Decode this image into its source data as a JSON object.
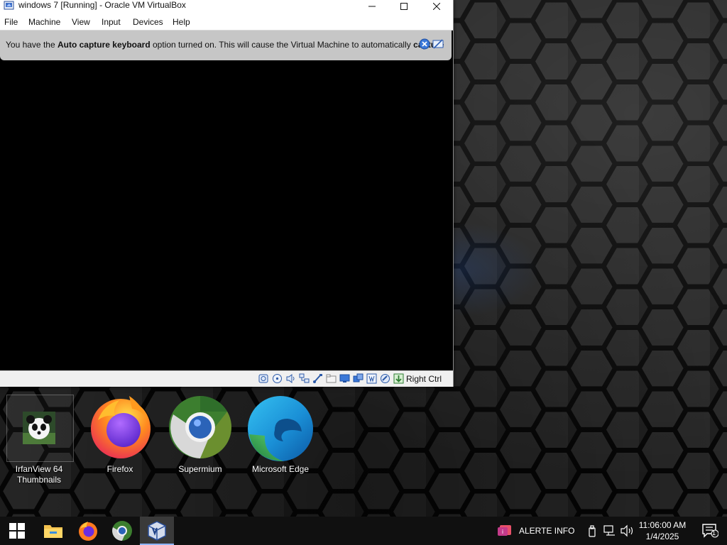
{
  "window": {
    "title": "windows 7 [Running] - Oracle VM VirtualBox",
    "menu": [
      "File",
      "Machine",
      "View",
      "Input",
      "Devices",
      "Help"
    ]
  },
  "notice": {
    "text_1": "You have the ",
    "bold_1": "Auto capture keyboard",
    "text_2": " option turned on. This will cause the Virtual Machine to automatically ",
    "bold_2": "capture"
  },
  "statusbar": {
    "icons": [
      "hard-disk-icon",
      "optical-drive-icon",
      "audio-icon",
      "network-icon",
      "usb-icon",
      "shared-folders-icon",
      "display-icon",
      "video-capture-icon",
      "recording-icon",
      "cpu-icon",
      "mouse-integration-icon",
      "keyboard-capture-icon"
    ],
    "host_key": "Right Ctrl"
  },
  "desktop": {
    "icons": [
      {
        "label_1": "IrfanView 64",
        "label_2": "Thumbnails",
        "icon": "irfanview-panda-icon"
      },
      {
        "label_1": "Firefox",
        "label_2": "",
        "icon": "firefox-icon"
      },
      {
        "label_1": "Supermium",
        "label_2": "",
        "icon": "supermium-icon"
      },
      {
        "label_1": "Microsoft Edge",
        "label_2": "",
        "icon": "edge-icon"
      }
    ]
  },
  "taskbar": {
    "alert": "ALERTE INFO",
    "time": "11:06:00 AM",
    "date": "1/4/2025",
    "notification_count": "1"
  },
  "colors": {
    "taskbar": "#101010",
    "accent": "#8fb5ff",
    "notice_bg": "#c6c6c6"
  }
}
